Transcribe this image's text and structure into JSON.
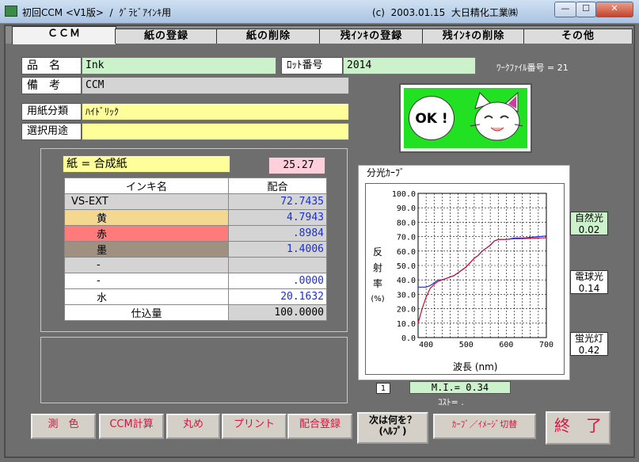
{
  "window": {
    "title": "初回CCM <V1版>  /  ｸﾞﾗﾋﾞｱｲﾝｷ用",
    "copyright": "(c)  2003.01.15  大日精化工業㈱",
    "min": "—",
    "max": "☐",
    "close": "✕"
  },
  "tabs": [
    {
      "label": "ＣＣＭ"
    },
    {
      "label": "紙の登録"
    },
    {
      "label": "紙の削除"
    },
    {
      "label": "残ｲﾝｷの登録"
    },
    {
      "label": "残ｲﾝｷの削除"
    },
    {
      "label": "その他"
    }
  ],
  "form": {
    "hinmei_label": "品　名",
    "hinmei_value": "Ink",
    "lot_label": "ﾛｯﾄ番号",
    "lot_value": "2014",
    "work_file": "ﾜｰｸﾌｧｲﾙ番号 = 21",
    "biko_label": "備　考",
    "biko_value": "CCM",
    "paper_class_label": "用紙分類",
    "paper_class_value": "ﾊｲﾄﾞﾘｯｸ",
    "purpose_label": "選択用途",
    "purpose_value": ""
  },
  "ok_badge": "OK !",
  "paper": {
    "label": "紙 = 合成紙",
    "value": "25.27"
  },
  "mix_table": {
    "headers": [
      "インキ名",
      "配合"
    ],
    "rows": [
      {
        "name": "VS-EXT",
        "value": "72.7435",
        "bg": "#d4d4d4"
      },
      {
        "name": "黄",
        "value": "4.7943",
        "bg": "#f5d890"
      },
      {
        "name": "赤",
        "value": ".8984",
        "bg": "#ff7a7a"
      },
      {
        "name": "墨",
        "value": "1.4006",
        "bg": "#a09080"
      },
      {
        "name": "-",
        "value": "",
        "bg": "#d4d4d4"
      },
      {
        "name": "-",
        "value": ".0000",
        "bg": "#ffffff"
      },
      {
        "name": "水",
        "value": "20.1632",
        "bg": "#ffffff"
      }
    ],
    "total_label": "仕込量",
    "total_value": "100.0000"
  },
  "spectral": {
    "frame_title": "分光ｶｰﾌﾞ",
    "y_label_chars": [
      "反",
      "射",
      "率",
      "(%)"
    ],
    "x_label": "波長 (nm)"
  },
  "chart_data": {
    "type": "line",
    "xlabel": "波長 (nm)",
    "ylabel": "反射率 (%)",
    "xlim": [
      380,
      700
    ],
    "ylim": [
      0,
      100
    ],
    "x_ticks": [
      400,
      500,
      600,
      700
    ],
    "y_ticks": [
      "0.0",
      "10.0",
      "20.0",
      "30.0",
      "40.0",
      "50.0",
      "60.0",
      "70.0",
      "80.0",
      "90.0",
      "100.0"
    ],
    "grid": true,
    "series": [
      {
        "color": "#1a2fd8",
        "x": [
          380,
          390,
          400,
          410,
          420,
          430,
          440,
          450,
          460,
          470,
          480,
          490,
          500,
          510,
          520,
          530,
          540,
          550,
          560,
          570,
          580,
          590,
          600,
          610,
          620,
          630,
          640,
          650,
          660,
          670,
          680,
          690,
          700
        ],
        "y": [
          35,
          35,
          35,
          36,
          38,
          40,
          40,
          41,
          42,
          43,
          45,
          47,
          49,
          52,
          55,
          57,
          60,
          62,
          64,
          67,
          68,
          68,
          68,
          68.5,
          69,
          69,
          69,
          69.2,
          69.5,
          69.8,
          70,
          70.2,
          70.5
        ]
      },
      {
        "color": "#c8102e",
        "x": [
          380,
          390,
          400,
          410,
          420,
          430,
          440,
          450,
          460,
          470,
          480,
          490,
          500,
          510,
          520,
          530,
          540,
          550,
          560,
          570,
          580,
          590,
          600,
          610,
          620,
          630,
          640,
          650,
          660,
          670,
          680,
          690,
          700
        ],
        "y": [
          10,
          20,
          28,
          34,
          37,
          39,
          40,
          41,
          42,
          43,
          45,
          47,
          49,
          52,
          55,
          57,
          60,
          62,
          64,
          67,
          68,
          68,
          68,
          68.3,
          68.5,
          68.5,
          68.6,
          68.7,
          68.8,
          68.9,
          69,
          69.1,
          69.2
        ]
      }
    ]
  },
  "lights": [
    {
      "name": "自然光",
      "value": "0.02",
      "bg": "#ccf2cc"
    },
    {
      "name": "電球光",
      "value": "0.14",
      "bg": "#ffffff"
    },
    {
      "name": "蛍光灯",
      "value": "0.42",
      "bg": "#ffffff"
    }
  ],
  "page_no": "1",
  "mi": "M.I.= 0.34",
  "cost": "ｺｽﾄ= .",
  "buttons": {
    "sokushoku": "測　色",
    "ccm_calc": "CCM計算",
    "marume": "丸め",
    "print": "プリント",
    "haigo_toroku": "配合登録",
    "next_line1": "次は何を？",
    "next_line2": "(ﾍﾙﾌﾟ)",
    "curve_switch": "ｶｰﾌﾞ／ｲﾒｰｼﾞ切替",
    "end": "終　了"
  }
}
